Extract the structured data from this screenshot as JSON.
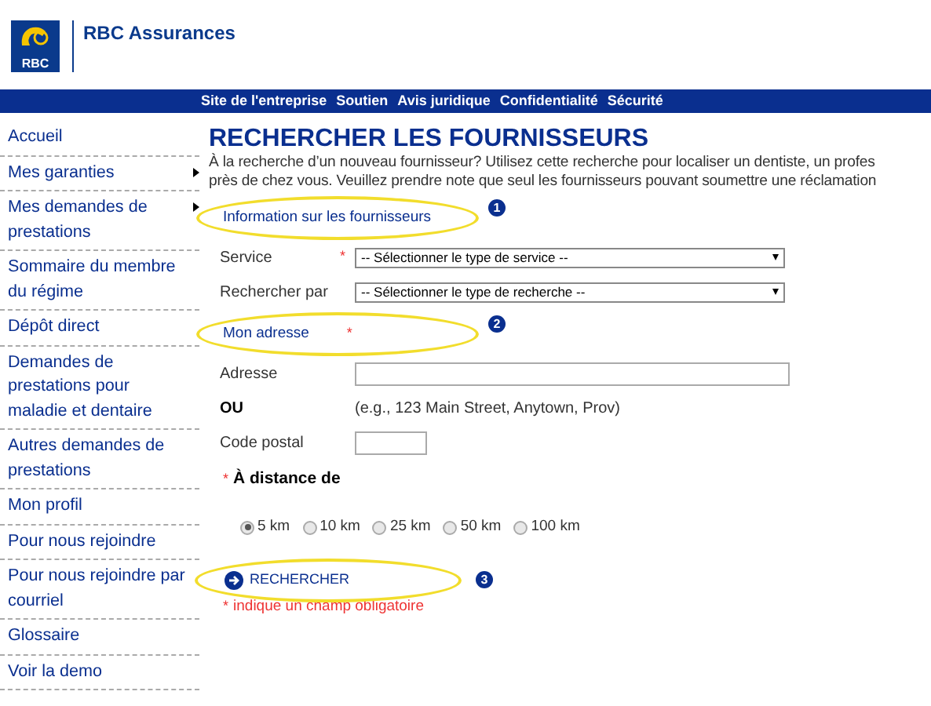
{
  "header": {
    "brand": "RBC Assurances",
    "logo_text": "RBC"
  },
  "nav": [
    "Site de l'entreprise",
    "Soutien",
    "Avis juridique",
    "Confidentialité",
    "Sécurité"
  ],
  "sidebar": {
    "items": [
      {
        "label": "Accueil",
        "has_submenu": false
      },
      {
        "label": "Mes garanties",
        "has_submenu": true
      },
      {
        "label": "Mes demandes de prestations",
        "has_submenu": true
      },
      {
        "label": "Sommaire du membre du régime",
        "has_submenu": false
      },
      {
        "label": "Dépôt direct",
        "has_submenu": false
      },
      {
        "label": "Demandes de prestations pour maladie et dentaire",
        "has_submenu": false
      },
      {
        "label": "Autres demandes de prestations",
        "has_submenu": false
      },
      {
        "label": "Mon profil",
        "has_submenu": false
      },
      {
        "label": "Pour nous rejoindre",
        "has_submenu": false
      },
      {
        "label": "Pour nous rejoindre par courriel",
        "has_submenu": false
      },
      {
        "label": "Glossaire",
        "has_submenu": false
      },
      {
        "label": "Voir la demo",
        "has_submenu": false
      }
    ]
  },
  "page": {
    "title": "RECHERCHER LES FOURNISSEURS",
    "intro": [
      "À la recherche d’un nouveau fournisseur? Utilisez cette recherche pour localiser un dentiste, un profes",
      "près de chez vous. Veuillez prendre note que seul les fournisseurs pouvant soumettre une réclamation"
    ]
  },
  "sections": [
    {
      "title": "Information sur les fournisseurs",
      "required": false,
      "badge": "1",
      "fields": [
        {
          "kind": "select",
          "label": "Service",
          "required": true,
          "value": "-- Sélectionner le type de service --"
        },
        {
          "kind": "select",
          "label": "Rechercher par",
          "required": false,
          "value": "-- Sélectionner le type de recherche --"
        }
      ]
    },
    {
      "title": "Mon adresse",
      "required": true,
      "badge": "2",
      "fields": [
        {
          "kind": "text",
          "label": "Adresse",
          "required": false
        },
        {
          "kind": "note",
          "label": "OU",
          "required": false,
          "value": "(e.g., 123 Main Street, Anytown, Prov)"
        },
        {
          "kind": "short_text",
          "label": "Code postal",
          "required": false
        }
      ]
    }
  ],
  "distance": {
    "label": "À distance de",
    "required": true,
    "options": [
      {
        "label": "5 km",
        "selected": true
      },
      {
        "label": "10 km",
        "selected": false
      },
      {
        "label": "25 km",
        "selected": false
      },
      {
        "label": "50 km",
        "selected": false
      },
      {
        "label": "100 km",
        "selected": false
      }
    ]
  },
  "search_button": {
    "label": "RECHERCHER",
    "badge": "3"
  },
  "required_note": {
    "mark": "*",
    "text": "indique un champ obligatoire"
  }
}
